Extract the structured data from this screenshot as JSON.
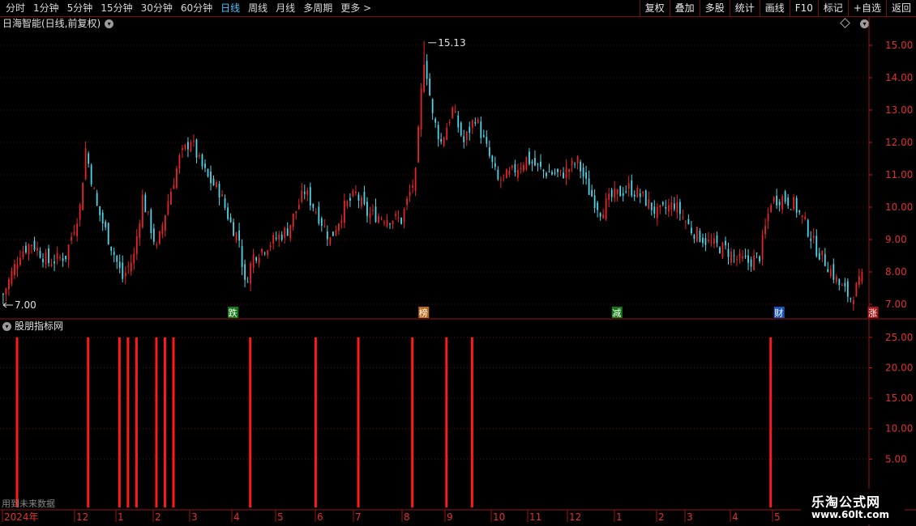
{
  "toolbar": {
    "periods": [
      "分时",
      "1分钟",
      "5分钟",
      "15分钟",
      "30分钟",
      "60分钟",
      "日线",
      "周线",
      "月线",
      "多周期",
      "更多 >"
    ],
    "active_index": 6,
    "buttons": [
      "复权",
      "叠加",
      "多股",
      "统计",
      "画线",
      "F10",
      "标记",
      "+自选",
      "返回"
    ]
  },
  "chart": {
    "stock_title": "日海智能(日线,前复权)",
    "high_label": "15.13",
    "low_label": "7.00",
    "price_ticks": [
      "15.00",
      "14.00",
      "13.00",
      "12.00",
      "11.00",
      "10.00",
      "9.00",
      "8.00",
      "7.00"
    ],
    "price_tick_values": [
      15,
      14,
      13,
      12,
      11,
      10,
      9,
      8,
      7
    ],
    "up_color": "#e8242a",
    "down_color": "#4ed6e8",
    "markers": [
      {
        "label": "跌",
        "bg": "#157a15",
        "date_index": 81
      },
      {
        "label": "榜",
        "bg": "#b86a1a",
        "date_index": 148
      },
      {
        "label": "减",
        "bg": "#157a15",
        "date_index": 216
      },
      {
        "label": "财",
        "bg": "#1a55b8",
        "date_index": 273
      },
      {
        "label": "涨",
        "bg": "#aa1515",
        "date_index": 306
      }
    ]
  },
  "indicator": {
    "title": "股朋指标网",
    "ticks": [
      "25.00",
      "20.00",
      "15.00",
      "10.00",
      "5.00"
    ],
    "tick_values": [
      25,
      20,
      15,
      10,
      5
    ],
    "bar_color": "#ff1a1a",
    "signal_value": 25,
    "signal_indices": [
      5,
      30,
      41,
      44,
      47,
      54,
      57,
      60,
      87,
      110,
      125,
      144,
      156,
      165,
      270
    ]
  },
  "footer_note": "用到未来数据",
  "xaxis": [
    "2024年",
    "12",
    "1",
    "2",
    "3",
    "4",
    "5",
    "6",
    "7",
    "8",
    "9",
    "10",
    "11",
    "12",
    "1",
    "2",
    "3",
    "4",
    "5"
  ],
  "watermark": {
    "line1": "乐淘公式网",
    "line2": "www.60lt.com"
  }
}
